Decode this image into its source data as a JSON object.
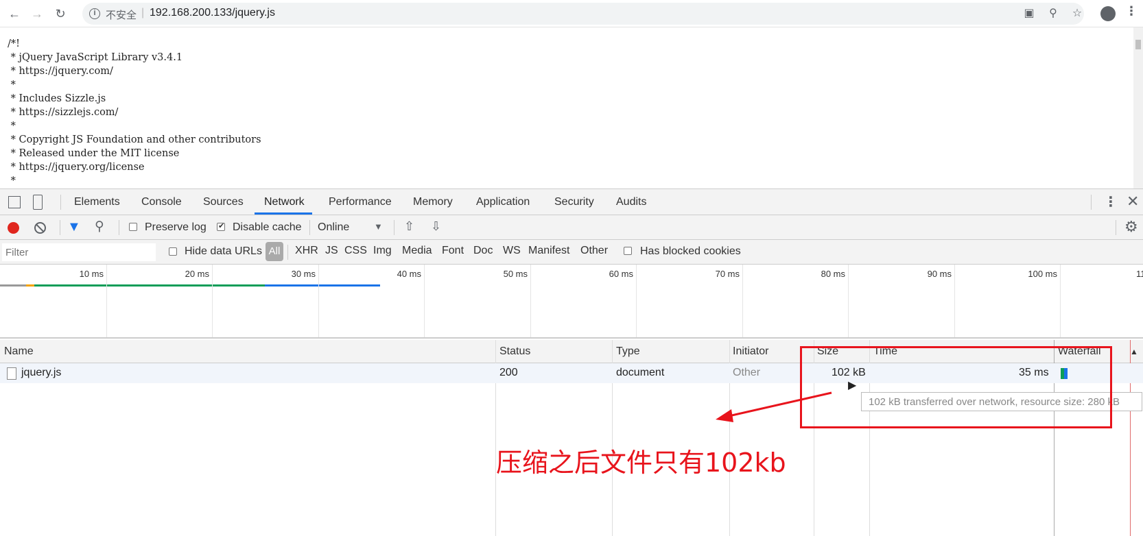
{
  "browser": {
    "back_icon": "back-arrow-icon",
    "insecure_label": "不安全",
    "url": "192.168.200.133/jquery.js"
  },
  "source": {
    "lines": [
      "/*!",
      " * jQuery JavaScript Library v3.4.1",
      " * https://jquery.com/",
      " *",
      " * Includes Sizzle.js",
      " * https://sizzlejs.com/",
      " *",
      " * Copyright JS Foundation and other contributors",
      " * Released under the MIT license",
      " * https://jquery.org/license",
      " *"
    ]
  },
  "devtools": {
    "tabs": [
      "Elements",
      "Console",
      "Sources",
      "Network",
      "Performance",
      "Memory",
      "Application",
      "Security",
      "Audits"
    ],
    "active_tab": "Network",
    "toolbar": {
      "preserve_log": "Preserve log",
      "disable_cache": "Disable cache",
      "throttle": "Online"
    },
    "filterbar": {
      "placeholder": "Filter",
      "hide_data_urls": "Hide data URLs",
      "all": "All",
      "types": [
        "XHR",
        "JS",
        "CSS",
        "Img",
        "Media",
        "Font",
        "Doc",
        "WS",
        "Manifest",
        "Other"
      ],
      "has_blocked_cookies": "Has blocked cookies"
    },
    "overview": {
      "ticks": [
        "10 ms",
        "20 ms",
        "30 ms",
        "40 ms",
        "50 ms",
        "60 ms",
        "70 ms",
        "80 ms",
        "90 ms",
        "100 ms",
        "11"
      ]
    },
    "table": {
      "headers": [
        "Name",
        "Status",
        "Type",
        "Initiator",
        "Size",
        "Time",
        "Waterfall"
      ],
      "rows": [
        {
          "name": "jquery.js",
          "status": "200",
          "type": "document",
          "initiator": "Other",
          "size": "102 kB",
          "time": "35 ms"
        }
      ],
      "tooltip": "102 kB transferred over network, resource size: 280 kB"
    }
  },
  "annotation": {
    "text": "压缩之后文件只有102kb",
    "color": "#e8141c"
  }
}
